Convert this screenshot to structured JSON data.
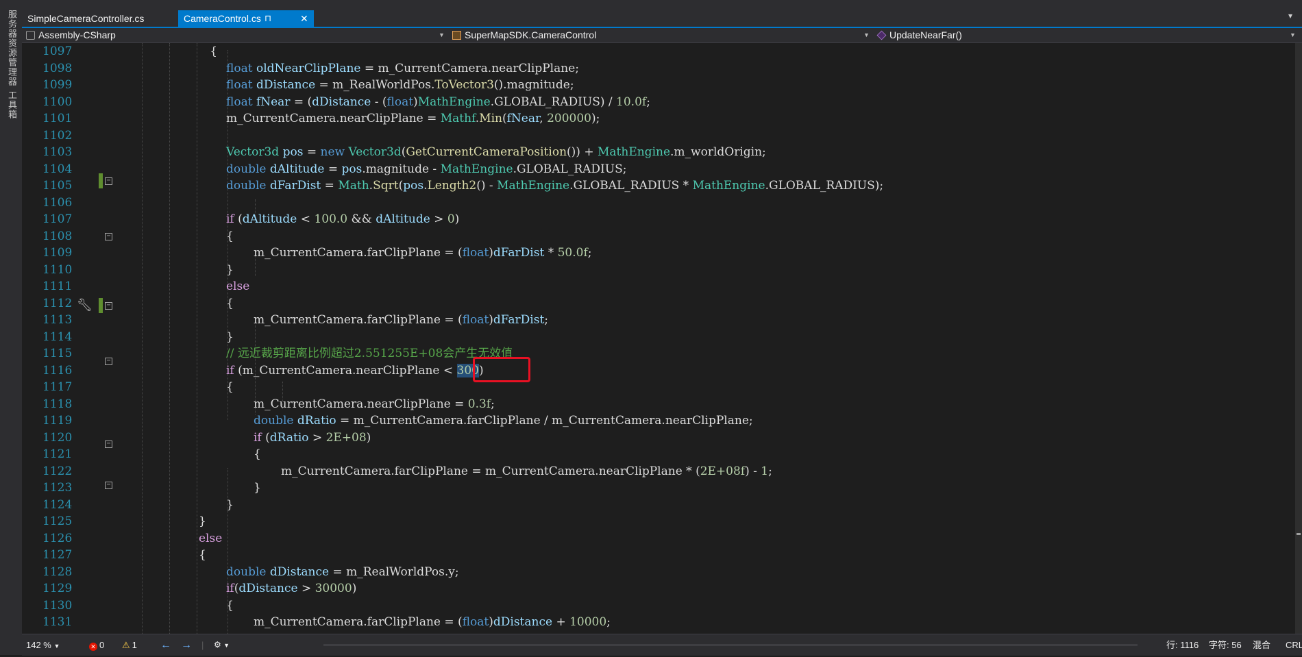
{
  "side": {
    "labels": [
      "服务器资源管理器",
      "工具箱"
    ]
  },
  "tabs": [
    {
      "label": "SimpleCameraController.cs",
      "active": false
    },
    {
      "label": "CameraControl.cs",
      "active": true,
      "pin": "⊓",
      "close": "✕"
    }
  ],
  "tab_overflow": "▾",
  "nav": {
    "project": "Assembly-CSharp",
    "type": "SuperMapSDK.CameraControl",
    "member": "UpdateNearFar()",
    "icons": [
      "project-icon",
      "class-icon",
      "method-icon"
    ]
  },
  "editor": {
    "line_numbers": [
      "1097",
      "1098",
      "1099",
      "1100",
      "1101",
      "1102",
      "1103",
      "1104",
      "1105",
      "1106",
      "1107",
      "1108",
      "1109",
      "1110",
      "1111",
      "1112",
      "1113",
      "1114",
      "1115",
      "1116",
      "1117",
      "1118",
      "1119",
      "1120",
      "1121",
      "1122",
      "1123",
      "1124",
      "1125",
      "1126",
      "1127",
      "1128",
      "1129",
      "1130",
      "1131"
    ],
    "highlight_text": "< 300)"
  },
  "status": {
    "zoom": "142 %",
    "errors": "0",
    "warnings": "1",
    "line": "行: 1116",
    "col": "字符: 56",
    "mode": "混合",
    "eol": "CRLF"
  },
  "colors": {
    "accent": "#007acc",
    "keyword": "#569cd6",
    "type": "#4ec9b0",
    "number": "#b5cea8",
    "comment": "#57a64a",
    "line_number": "#2b91af",
    "highlight_border": "#e81123"
  }
}
